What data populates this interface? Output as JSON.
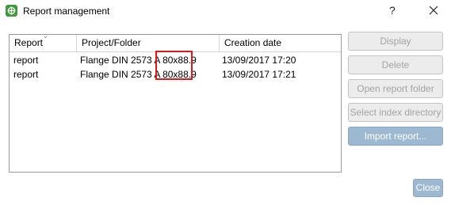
{
  "window": {
    "title": "Report management",
    "help_label": "?",
    "app_icon": "report-icon",
    "close_icon": "close-icon"
  },
  "table": {
    "columns": [
      "Report",
      "Project/Folder",
      "Creation date"
    ],
    "sort_column": "Report",
    "sort_indicator": "⌄",
    "rows": [
      {
        "report": "report",
        "project": "Flange DIN 2573 A 80x88.9",
        "date": "13/09/2017 17:20"
      },
      {
        "report": "report",
        "project": "Flange DIN 2573 A 80x88.9",
        "date": "13/09/2017 17:21"
      }
    ]
  },
  "annotation": {
    "highlight_color": "#e01818"
  },
  "buttons": {
    "display": "Display",
    "delete": "Delete",
    "open_folder": "Open report folder",
    "select_index": "Select index directory",
    "import": "Import report...",
    "close": "Close"
  },
  "colors": {
    "accent_button": "#9db9d1",
    "disabled_text": "#a3a3a3",
    "app_icon": "#3f9a3b"
  }
}
